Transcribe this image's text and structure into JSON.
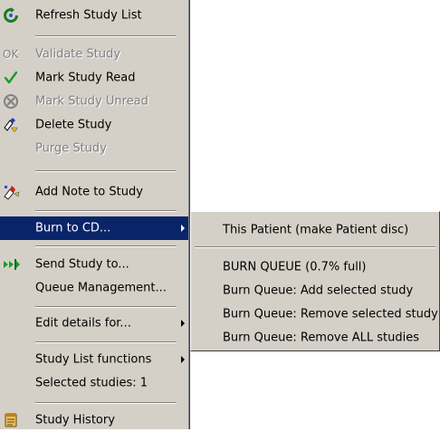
{
  "context_menu": {
    "items": [
      {
        "label": "Refresh Study List",
        "icon": "refresh-icon"
      },
      {
        "label": "Validate Study",
        "icon": "ok-icon",
        "icon_text": "OK",
        "disabled": true
      },
      {
        "label": "Mark Study Read",
        "icon": "checkmark-icon"
      },
      {
        "label": "Mark Study Unread",
        "icon": "unread-icon",
        "disabled": true
      },
      {
        "label": "Delete Study",
        "icon": "delete-icon"
      },
      {
        "label": "Purge Study",
        "disabled": true
      },
      {
        "label": "Add Note to Study",
        "icon": "note-icon"
      },
      {
        "label": "Burn to CD...",
        "selected": true,
        "has_submenu": true
      },
      {
        "label": "Send Study to...",
        "icon": "send-icon"
      },
      {
        "label": "Queue Management..."
      },
      {
        "label": "Edit details for...",
        "has_submenu": true
      },
      {
        "label": "Study List functions",
        "has_submenu": true
      },
      {
        "label": "Selected studies: 1"
      },
      {
        "label": "Study History",
        "icon": "history-icon"
      }
    ]
  },
  "submenu": {
    "items": [
      {
        "label": "This Patient (make Patient disc)"
      },
      {
        "label": "BURN QUEUE (0.7% full)"
      },
      {
        "label": "Burn Queue: Add selected study"
      },
      {
        "label": "Burn Queue: Remove selected study"
      },
      {
        "label": "Burn Queue: Remove ALL studies"
      }
    ]
  },
  "colors": {
    "menu_background": "#d4d0c8",
    "highlight": "#0a246a",
    "disabled_text": "#808080"
  }
}
